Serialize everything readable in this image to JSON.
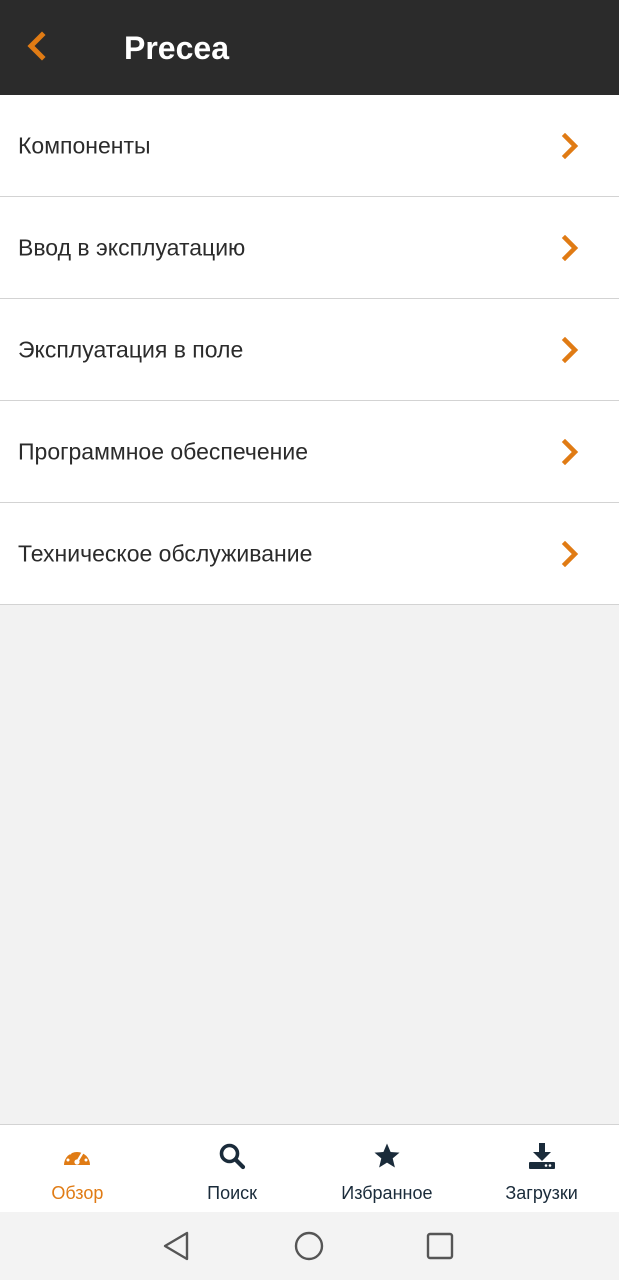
{
  "app_bar": {
    "title": "Precea",
    "back_icon": "chevron-left-icon"
  },
  "menu": {
    "items": [
      {
        "label": "Компоненты"
      },
      {
        "label": "Ввод в эксплуатацию"
      },
      {
        "label": "Эксплуатация в поле"
      },
      {
        "label": "Программное обеспечение"
      },
      {
        "label": "Техническое обслуживание"
      }
    ],
    "chevron_icon": "chevron-right-icon"
  },
  "bottom_nav": {
    "tabs": [
      {
        "label": "Обзор",
        "icon": "dashboard-icon",
        "active": true
      },
      {
        "label": "Поиск",
        "icon": "search-icon",
        "active": false
      },
      {
        "label": "Избранное",
        "icon": "star-icon",
        "active": false
      },
      {
        "label": "Загрузки",
        "icon": "download-icon",
        "active": false
      }
    ]
  },
  "system_nav": {
    "buttons": [
      "back-triangle-icon",
      "home-circle-icon",
      "recents-square-icon"
    ]
  },
  "colors": {
    "app_bar": "#2b2b2b",
    "accent": "#e07b14",
    "nav_icon": "#1a2b3a",
    "background": "#f2f2f2"
  }
}
